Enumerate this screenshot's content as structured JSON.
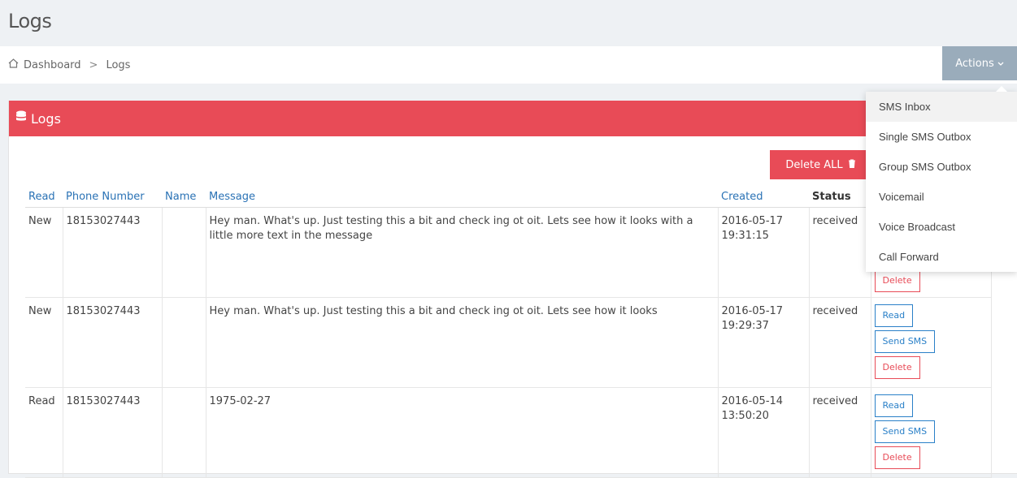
{
  "page": {
    "title": "Logs"
  },
  "breadcrumb": {
    "home": "Dashboard",
    "separator": ">",
    "current": "Logs"
  },
  "actions": {
    "label": "Actions"
  },
  "panel": {
    "title": "Logs",
    "delete_all": "Delete ALL"
  },
  "table": {
    "headers": {
      "read": "Read",
      "phone": "Phone Number",
      "name": "Name",
      "message": "Message",
      "created": "Created",
      "status": "Status"
    },
    "rows": [
      {
        "read": "New",
        "phone": "18153027443",
        "name": "",
        "message": "Hey man. What's up. Just testing this a bit and check ing ot oit. Lets see how it looks with a little more text in the message",
        "created": "2016-05-17 19:31:15",
        "status": "received"
      },
      {
        "read": "New",
        "phone": "18153027443",
        "name": "",
        "message": "Hey man. What's up. Just testing this a bit and check ing ot oit. Lets see how it looks",
        "created": "2016-05-17 19:29:37",
        "status": "received"
      },
      {
        "read": "Read",
        "phone": "18153027443",
        "name": "",
        "message": "1975-02-27",
        "created": "2016-05-14 13:50:20",
        "status": "received"
      }
    ],
    "row_buttons": {
      "read": "Read",
      "send": "Send SMS",
      "delete": "Delete"
    }
  },
  "dropdown": {
    "items": [
      "SMS Inbox",
      "Single SMS Outbox",
      "Group SMS Outbox",
      "Voicemail",
      "Voice Broadcast",
      "Call Forward"
    ]
  },
  "colors": {
    "accent": "#e84b57",
    "link": "#2a72b5",
    "actions_bg": "#9aacbb"
  },
  "icons": {
    "home": "home-icon",
    "database": "database-icon",
    "trash": "trash-icon",
    "chevron": "chevron-down-icon"
  }
}
